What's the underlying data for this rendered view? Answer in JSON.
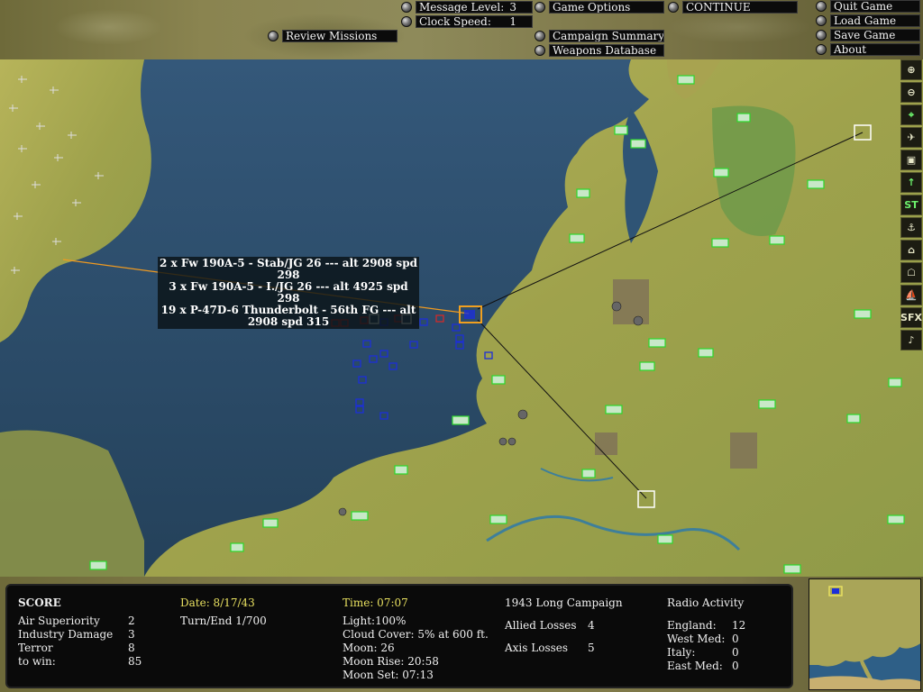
{
  "menu": {
    "message_level_label": "Message Level:",
    "message_level_value": "3",
    "clock_speed_label": "Clock Speed:",
    "clock_speed_value": "1",
    "review_missions": "Review Missions",
    "game_options": "Game Options",
    "continue": "CONTINUE",
    "campaign_summary": "Campaign Summary",
    "weapons_database": "Weapons Database",
    "quit_game": "Quit Game",
    "load_game": "Load Game",
    "save_game": "Save Game",
    "about": "About"
  },
  "toolbar": {
    "tools": [
      {
        "name": "zoom-in-icon",
        "glyph": "⊕"
      },
      {
        "name": "zoom-out-icon",
        "glyph": "⊖"
      },
      {
        "name": "target-icon",
        "glyph": "⌖"
      },
      {
        "name": "aircraft-filter-icon",
        "glyph": "✈"
      },
      {
        "name": "airfield-filter-icon",
        "glyph": "▣"
      },
      {
        "name": "flak-filter-icon",
        "glyph": "↑"
      },
      {
        "name": "strategic-targets-icon",
        "glyph": "ST"
      },
      {
        "name": "ports-filter-icon",
        "glyph": "⚓"
      },
      {
        "name": "industry-filter-icon",
        "glyph": "⌂"
      },
      {
        "name": "city-filter-icon",
        "glyph": "☖"
      },
      {
        "name": "ships-filter-icon",
        "glyph": "⛵"
      },
      {
        "name": "sfx-toggle-icon",
        "glyph": "SFX"
      },
      {
        "name": "music-toggle-icon",
        "glyph": "♪"
      }
    ]
  },
  "tooltip": {
    "lines": [
      "2 x Fw 190A-5 - Stab/JG 26  --- alt 2908 spd 298",
      "3 x Fw 190A-5 - I./JG 26  --- alt 4925 spd 298",
      "19 x P-47D-6 Thunderbolt - 56th FG  --- alt 2908 spd 315"
    ]
  },
  "score": {
    "title": "SCORE",
    "air_superiority_label": "Air Superiority",
    "air_superiority_value": "2",
    "industry_damage_label": "Industry Damage",
    "industry_damage_value": "3",
    "terror_label": "Terror",
    "terror_value": "8",
    "to_win_label": "to win:",
    "to_win_value": "85"
  },
  "date": {
    "date": "Date: 8/17/43",
    "turn": "Turn/End 1/700"
  },
  "weather": {
    "time": "Time: 07:07",
    "light": "Light:100%",
    "cloud_cover": "Cloud Cover:  5% at 600 ft.",
    "moon": "Moon: 26",
    "moon_rise": "Moon Rise: 20:58",
    "moon_set": "Moon Set: 07:13"
  },
  "campaign": {
    "name": "1943 Long Campaign",
    "allied_losses_label": "Allied Losses",
    "allied_losses_value": "4",
    "axis_losses_label": "Axis Losses",
    "axis_losses_value": "5"
  },
  "radio": {
    "title": "Radio Activity",
    "england_label": "England:",
    "england_value": "12",
    "west_med_label": "West Med:",
    "west_med_value": "0",
    "italy_label": "Italy:",
    "italy_value": "0",
    "east_med_label": "East Med:",
    "east_med_value": "0"
  },
  "colors": {
    "sea": "#2c4f6a",
    "land": "#a7a64f",
    "allied_unit": "#1d2fd8",
    "axis_unit": "#d02a2a",
    "selected_unit": "#f0a020",
    "airbase_outline": "#2cd82c",
    "highlight_text": "#e8e060"
  }
}
